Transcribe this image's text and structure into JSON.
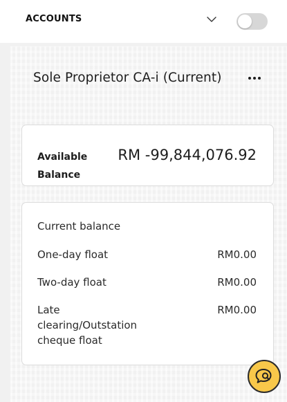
{
  "header": {
    "title": "ACCOUNTS",
    "toggle_state": "off"
  },
  "account": {
    "name": "Sole Proprietor CA-i (Current)"
  },
  "balance": {
    "label": "Available Balance",
    "value": "RM -99,844,076.92"
  },
  "details": {
    "current_balance_label": "Current balance",
    "rows": [
      {
        "label": "One-day float",
        "value": "RM0.00"
      },
      {
        "label": "Two-day float",
        "value": "RM0.00"
      },
      {
        "label": "Late clearing/Outstation cheque float",
        "value": "RM0.00"
      }
    ]
  },
  "colors": {
    "chat_button": "#f8c84a",
    "toggle_track": "#d7d7d7"
  },
  "icons": {
    "chevron": "chevron-down-icon",
    "more": "more-horizontal-icon",
    "chat": "chat-bubble-icon"
  }
}
